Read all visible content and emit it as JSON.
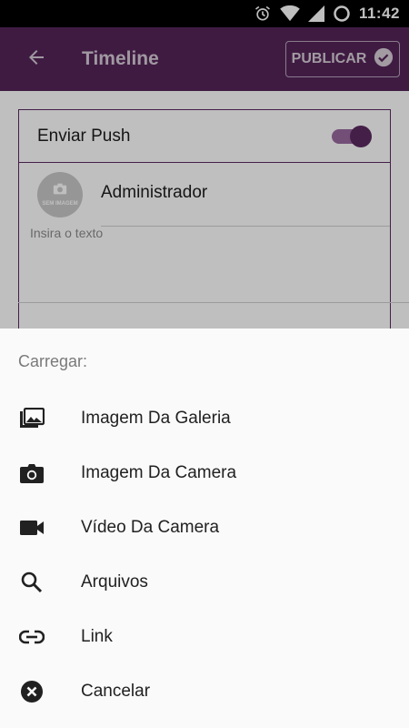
{
  "status_bar": {
    "time": "11:42",
    "icons": [
      "alarm-icon",
      "wifi-icon",
      "cell-signal-icon",
      "battery-icon"
    ]
  },
  "app_bar": {
    "title": "Timeline",
    "back_icon": "arrow-left-icon",
    "publish_label": "PUBLICAR",
    "publish_icon": "check-circle-icon",
    "background": "#552559"
  },
  "post_form": {
    "push_label": "Enviar Push",
    "push_enabled": true,
    "avatar_text": "SEM IMAGEM",
    "author_name": "Administrador",
    "text_placeholder": "Insira o texto"
  },
  "sheet": {
    "title": "Carregar:",
    "items": [
      {
        "label": "Imagem Da Galeria",
        "icon": "gallery-icon"
      },
      {
        "label": "Imagem Da Camera",
        "icon": "camera-icon"
      },
      {
        "label": "Vídeo Da Camera",
        "icon": "video-camera-icon"
      },
      {
        "label": "Arquivos",
        "icon": "search-icon"
      },
      {
        "label": "Link",
        "icon": "link-icon"
      },
      {
        "label": "Cancelar",
        "icon": "cancel-icon"
      }
    ]
  },
  "colors": {
    "accent": "#5b2a61",
    "toggle_track": "#9a6aa0"
  }
}
